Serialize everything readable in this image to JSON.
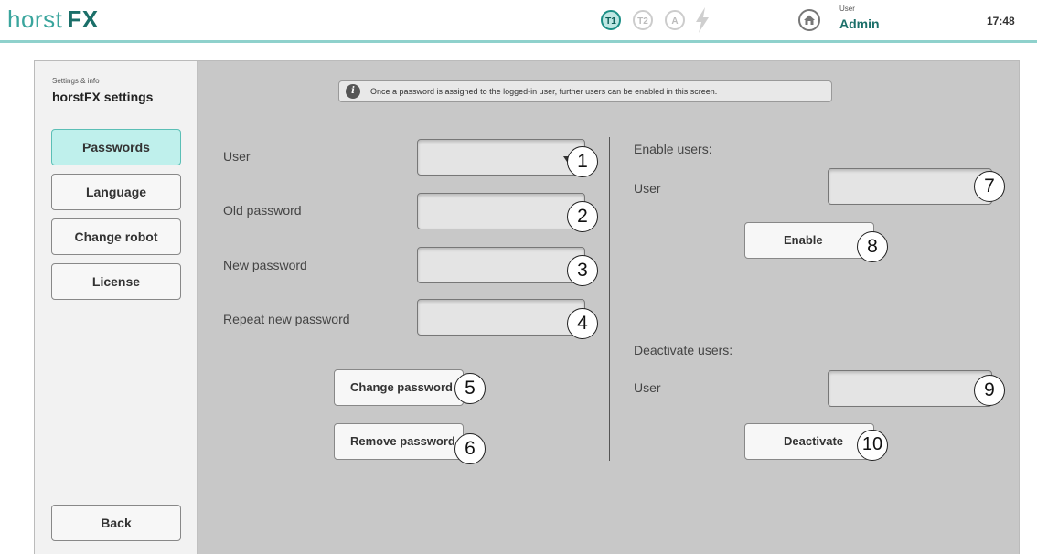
{
  "header": {
    "logo_text": "horst",
    "logo_bold": "FX",
    "modes": [
      "T1",
      "T2",
      "A"
    ],
    "active_mode": "T1",
    "user_caption": "User",
    "user_name": "Admin",
    "time": "17:48",
    "accent_color": "#3aa59d"
  },
  "sidebar": {
    "crumb": "Settings & info",
    "title": "horstFX settings",
    "items": [
      {
        "label": "Passwords",
        "active": true
      },
      {
        "label": "Language",
        "active": false
      },
      {
        "label": "Change robot",
        "active": false
      },
      {
        "label": "License",
        "active": false
      }
    ],
    "back_label": "Back"
  },
  "main": {
    "info_text": "Once a password is assigned to the logged-in user, further users can be enabled in this screen.",
    "left": {
      "user_label": "User",
      "user_value": "",
      "old_password_label": "Old password",
      "new_password_label": "New password",
      "repeat_password_label": "Repeat new password",
      "change_password_label": "Change password",
      "remove_password_label": "Remove password"
    },
    "right": {
      "enable_heading": "Enable users:",
      "enable_user_label": "User",
      "enable_label": "Enable",
      "deactivate_heading": "Deactivate users:",
      "deactivate_user_label": "User",
      "deactivate_label": "Deactivate"
    },
    "callouts": [
      "1",
      "2",
      "3",
      "4",
      "5",
      "6",
      "7",
      "8",
      "9",
      "10"
    ]
  }
}
